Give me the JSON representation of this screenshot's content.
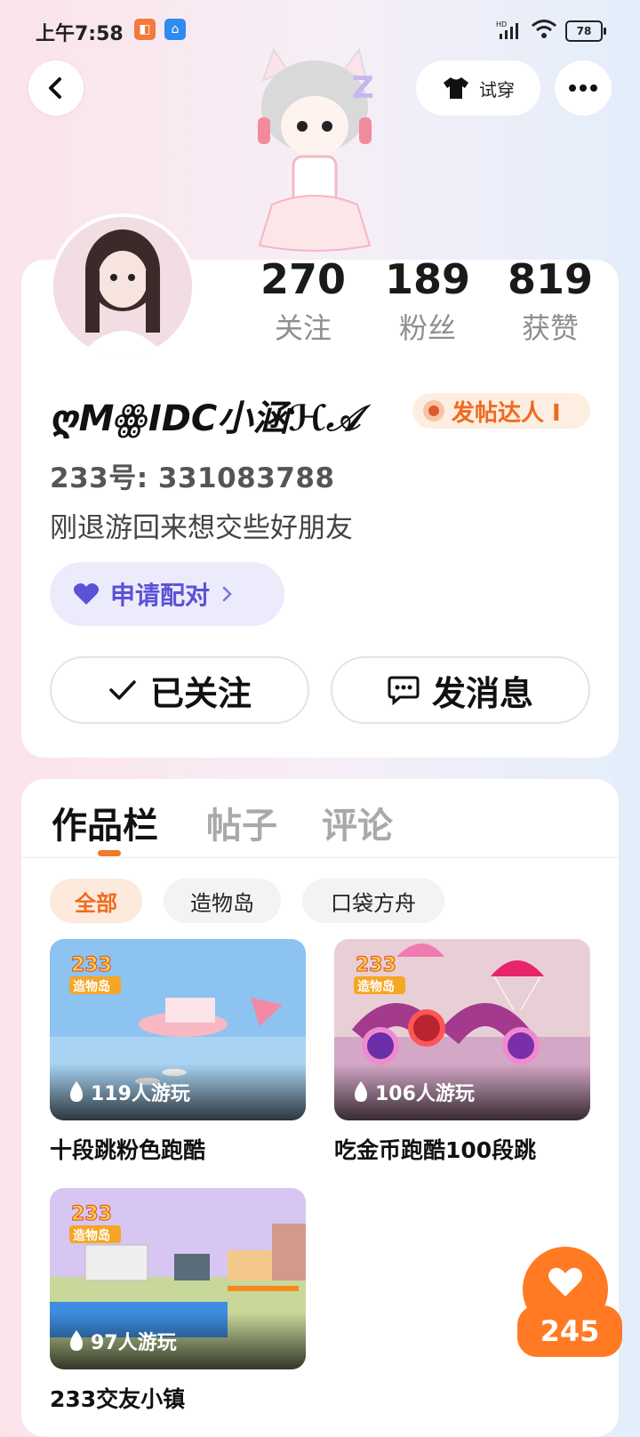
{
  "status_bar": {
    "time": "上午7:58",
    "network": "HD",
    "battery": "78"
  },
  "header": {
    "try_on_label": "试穿"
  },
  "profile": {
    "stats": [
      {
        "value": "270",
        "label": "关注"
      },
      {
        "value": "189",
        "label": "粉丝"
      },
      {
        "value": "819",
        "label": "获赞"
      }
    ],
    "name": "ღMꙮIDC小涵ℋ𝒜",
    "badge": "发帖达人 I",
    "uid": "233号: 331083788",
    "bio": "刚退游回来想交些好朋友",
    "pair_label": "申请配对",
    "follow_label": "已关注",
    "message_label": "发消息"
  },
  "tabs": [
    "作品栏",
    "帖子",
    "评论"
  ],
  "filters": [
    "全部",
    "造物岛",
    "口袋方舟"
  ],
  "works": [
    {
      "plays": "119人游玩",
      "title": "十段跳粉色跑酷",
      "logo_top": "233",
      "logo_bottom": "造物岛"
    },
    {
      "plays": "106人游玩",
      "title": "吃金币跑酷100段跳",
      "logo_top": "233",
      "logo_bottom": "造物岛"
    },
    {
      "plays": "97人游玩",
      "title": "233交友小镇",
      "logo_top": "233",
      "logo_bottom": "造物岛"
    }
  ],
  "like": {
    "count": "245"
  }
}
